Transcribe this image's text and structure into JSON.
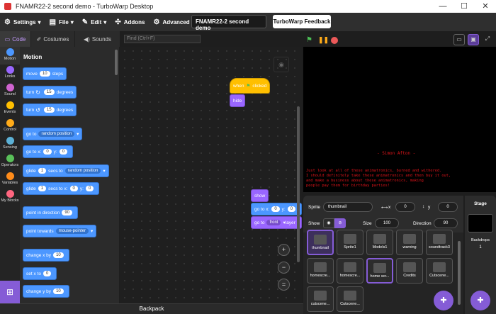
{
  "window": {
    "title": "FNAMR22-2 second demo - TurboWarp Desktop",
    "minimize": "—",
    "maximize": "☐",
    "close": "✕"
  },
  "menu": {
    "settings": "Settings",
    "file": "File",
    "edit": "Edit",
    "addons": "Addons",
    "advanced": "Advanced",
    "project_name": "FNAMR22-2 second demo",
    "feedback": "TurboWarp Feedback"
  },
  "tabs": {
    "code": "Code",
    "costumes": "Costumes",
    "sounds": "Sounds"
  },
  "find": {
    "placeholder": "Find (Ctrl+F)"
  },
  "categories": [
    {
      "label": "Motion",
      "color": "#4c97ff"
    },
    {
      "label": "Looks",
      "color": "#9966ff"
    },
    {
      "label": "Sound",
      "color": "#cf63cf"
    },
    {
      "label": "Events",
      "color": "#ffbf00"
    },
    {
      "label": "Control",
      "color": "#ffab19"
    },
    {
      "label": "Sensing",
      "color": "#5cb1d6"
    },
    {
      "label": "Operators",
      "color": "#59c059"
    },
    {
      "label": "Variables",
      "color": "#ff8c1a"
    },
    {
      "label": "My Blocks",
      "color": "#ff6680"
    }
  ],
  "palette": {
    "heading": "Motion",
    "move": {
      "a": "move",
      "v": "10",
      "b": "steps"
    },
    "turn_cw": {
      "a": "turn",
      "v": "15",
      "b": "degrees"
    },
    "turn_ccw": {
      "a": "turn",
      "v": "15",
      "b": "degrees"
    },
    "goto": {
      "a": "go to",
      "v": "random position"
    },
    "gotoxy": {
      "a": "go to x:",
      "x": "0",
      "b": "y:",
      "y": "0"
    },
    "glide_to": {
      "a": "glide",
      "v": "1",
      "b": "secs to",
      "c": "random position"
    },
    "glide_xy": {
      "a": "glide",
      "v": "1",
      "b": "secs to x:",
      "x": "0",
      "c": "y:",
      "y": "0"
    },
    "point_dir": {
      "a": "point in direction",
      "v": "90"
    },
    "point_towards": {
      "a": "point towards",
      "v": "mouse-pointer"
    },
    "change_x": {
      "a": "change x by",
      "v": "10"
    },
    "set_x": {
      "a": "set x to",
      "v": "0"
    },
    "change_y": {
      "a": "change y by",
      "v": "10"
    }
  },
  "workspace": {
    "when_flag": {
      "a": "when",
      "b": "clicked"
    },
    "hide": "hide",
    "show": "show",
    "gotoxy": {
      "a": "go to x:",
      "x": "0",
      "b": "y:",
      "y": "0"
    },
    "goto_layer": {
      "a": "go to",
      "v": "front",
      "b": "layer"
    },
    "zoom_in": "+",
    "zoom_out": "−",
    "zoom_reset": "="
  },
  "backpack": "Backpack",
  "stage": {
    "name_line": "- Simon Afton -",
    "text": "Just look at all of these animatronics, burned and withered.\nI should definitely take these animatronics and then buy it out,\nand make a business about these animatronics, making\npeople pay them for birthday parties!"
  },
  "sprite_info": {
    "sprite_label": "Sprite",
    "sprite_name": "thumbnail",
    "x_label": "x",
    "x": "0",
    "y_label": "y",
    "y": "0",
    "show_label": "Show",
    "size_label": "Size",
    "size": "100",
    "direction_label": "Direction",
    "direction": "90"
  },
  "sprites": [
    "thumbnail",
    "Sprite1",
    "Models1",
    "warning",
    "soundtrack3",
    "homescre...",
    "homescre...",
    "home scr...",
    "Credits",
    "Cutscene...",
    "cutscene...",
    "Cutscene..."
  ],
  "stage_pane": {
    "title": "Stage",
    "backdrops_label": "Backdrops",
    "backdrops": "1"
  }
}
